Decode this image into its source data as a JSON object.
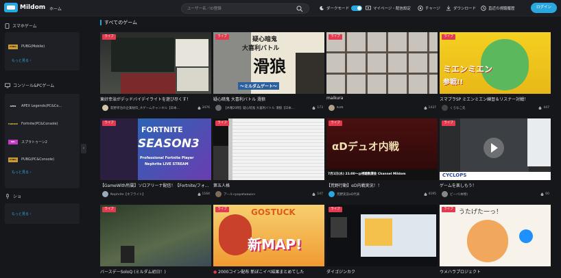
{
  "header": {
    "brand": "Mildom",
    "home": "ホーム",
    "search_placeholder": "ユーザー名／ID登録",
    "dark_mode": "ダークモード",
    "my_page": "マイページ・配信設定",
    "charge": "チャージ",
    "download": "ダウンロード",
    "history": "直近の視聴履歴",
    "login": "ログイン"
  },
  "sidebar": {
    "mobile_title": "スマホゲーム",
    "mobile_items": [
      {
        "label": "PUBG(Mobile)",
        "thumb": "PUBG"
      }
    ],
    "more": "もっと見る ›",
    "console_title": "コンソール&PCゲーム",
    "console_items": [
      {
        "label": "APEX Legends(PC&Co...",
        "thumb": "APEX"
      },
      {
        "label": "Fortnite(PC&Console)",
        "thumb": "FORTNITE"
      },
      {
        "label": "スプラトゥーン2",
        "thumb": "SPL"
      },
      {
        "label": "PUBG(PC&Console)",
        "thumb": "PUBG"
      }
    ],
    "show_title": "ショ"
  },
  "section_title": "すべてのゲーム",
  "live_label": "ライブ",
  "cards": [
    {
      "title": "東好幸治がデッドバイデイライトを遊び尽くす！",
      "streamer": "萩野孝治の企業秘伝_ネゲームチャンネル【日本...",
      "viewers": "3476"
    },
    {
      "title": "疑心暗鬼 大喜利バトル 滑狼",
      "streamer": "【木曜20時】疑心暗鬼 大喜利バトル 滑狼【日本...",
      "viewers": "173"
    },
    {
      "title": "maikura",
      "streamer": "KUN",
      "viewers": "1437"
    },
    {
      "title": "スマブラSP ミエンミエン練習＆リスナー対戦！",
      "streamer": "くろなこ先",
      "viewers": "447"
    },
    {
      "title": "【GameWith所属】ソロアリーナ配信！【Fortnite/フォ...",
      "streamer": "Nephrite【ネフライト】",
      "viewers": "1164"
    },
    {
      "title": "第五人格",
      "streamer": "アール<papatwawa>",
      "viewers": "147"
    },
    {
      "title": "【荒野行動】αD内戦実況！！",
      "streamer": "荒野実況αD代表",
      "viewers": "4195"
    },
    {
      "title": "ゲームを楽しもう！",
      "streamer": "ビーバ(本物)",
      "viewers": "60"
    },
    {
      "title": "バースデーSoloQ (ミルダム初日！)",
      "streamer": "",
      "viewers": ""
    },
    {
      "title": "2000コイン配布 新ぼこイベ結果まとめてした",
      "streamer": "",
      "viewers": ""
    },
    {
      "title": "ダイゴジンカク",
      "streamer": "",
      "viewers": ""
    },
    {
      "title": "ウメハラプロジェクト",
      "streamer": "",
      "viewers": ""
    }
  ],
  "overlay": {
    "fortnite": "FORTNITE",
    "season3": "SEASON3",
    "fortnite_sub": "Professional Fortnite Player",
    "fortnite_sub2": "Nephrite LIVE STREAM",
    "kanji_big": "滑狼",
    "kanji_top": "疑心暗鬼",
    "kanji_mid": "大喜利バトル",
    "kanji_small": "〜ミルダムゲート〜",
    "mien": "ミエンミエン",
    "mien2": "参戦!!",
    "alpha_title": "αDデュオ内戦",
    "alpha_sub": "7月1日(水) 21:00〜@視聴数課金 Channel Mildom",
    "cyclops": "CYCLOPS",
    "gostuck": "GOSTUCK",
    "shinmap": "新MAP!",
    "umaru": "うたげた一っ！"
  },
  "colors": {
    "accent": "#2aa7df",
    "live": "#e23b4f",
    "bg": "#16171b"
  }
}
